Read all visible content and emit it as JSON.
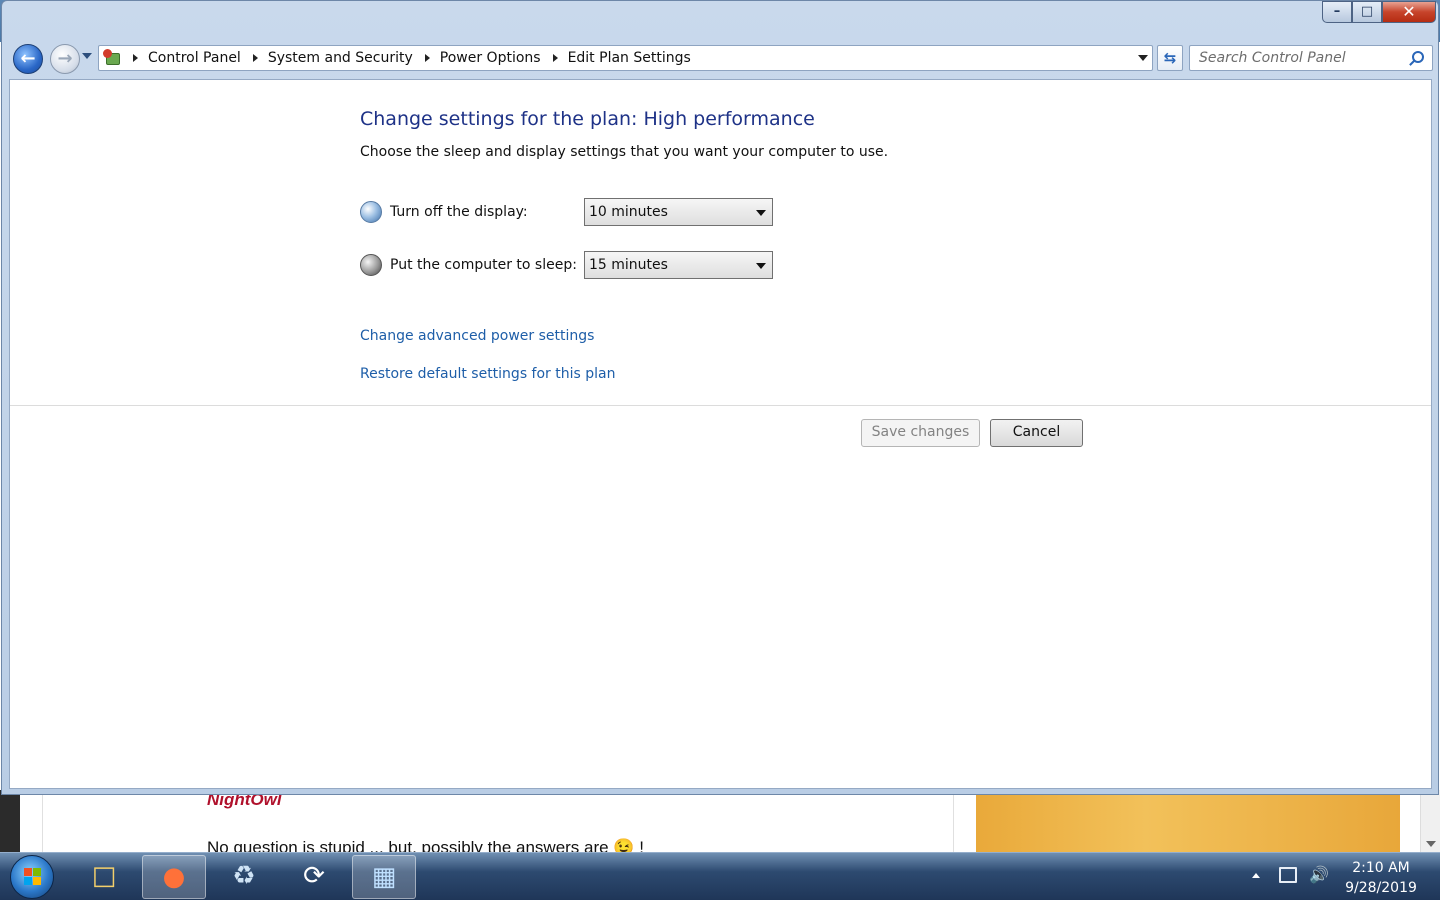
{
  "background": {
    "signature": "NightOwl",
    "quote": "No question is stupid ... but, possibly the answers are 😉 !"
  },
  "window": {
    "caption_buttons": {
      "minimize": "–",
      "maximize": "□",
      "close": "✕"
    }
  },
  "address_bar": {
    "breadcrumbs": [
      "Control Panel",
      "System and Security",
      "Power Options",
      "Edit Plan Settings"
    ],
    "icon": "control-panel-icon"
  },
  "search": {
    "placeholder": "Search Control Panel"
  },
  "page": {
    "title": "Change settings for the plan: High performance",
    "description": "Choose the sleep and display settings that you want your computer to use.",
    "settings": {
      "display": {
        "label": "Turn off the display:",
        "value": "10 minutes",
        "icon": "display-icon"
      },
      "sleep": {
        "label": "Put the computer to sleep:",
        "value": "15 minutes",
        "icon": "moon-icon"
      }
    },
    "links": {
      "advanced": "Change advanced power settings",
      "restore": "Restore default settings for this plan"
    },
    "buttons": {
      "save": "Save changes",
      "cancel": "Cancel"
    }
  },
  "taskbar": {
    "items": [
      "windows-explorer",
      "firefox",
      "recycle-bin",
      "update-tool",
      "control-panel"
    ],
    "clock": {
      "time": "2:10 AM",
      "date": "9/28/2019"
    }
  },
  "colors": {
    "title_blue": "#1e3287",
    "link_blue": "#1e5ea8",
    "taskbar": "#2d4a70"
  }
}
